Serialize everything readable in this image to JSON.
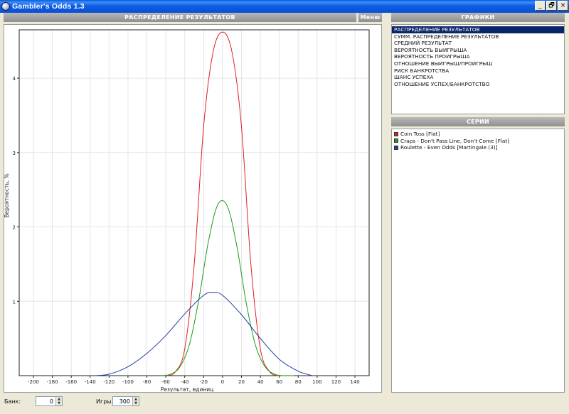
{
  "window": {
    "title": "Gambler's Odds 1.3",
    "buttons": [
      "_",
      "🗗",
      "×"
    ]
  },
  "chart_panel": {
    "header": "РАСПРЕДЕЛЕНИЕ РЕЗУЛЬТАТОВ",
    "menu_label": "Меню"
  },
  "graphs_panel": {
    "header": "ГРАФИКИ",
    "items": [
      "РАСПРЕДЕЛЕНИЕ РЕЗУЛЬТАТОВ",
      "СУММ. РАСПРЕДЕЛЕНИЕ РЕЗУЛЬТАТОВ",
      "СРЕДНИЙ РЕЗУЛЬТАТ",
      "ВЕРОЯТНОСТЬ ВЫИГРЫША",
      "ВЕРОЯТНОСТЬ ПРОИГРЫША",
      "ОТНОШЕНИЕ ВЫИГРЫШ/ПРОИГРЫШ",
      "РИСК БАНКРОТСТВА",
      "ШАНС УСПЕХА",
      "ОТНОШЕНИЕ УСПЕХ/БАНКРОТСТВО"
    ],
    "selected_index": 0
  },
  "series_panel": {
    "header": "СЕРИИ",
    "items": [
      {
        "label": "Coin Toss [Flat]",
        "color": "#e02020"
      },
      {
        "label": "Craps - Don't Pass Line, Don't Come [Flat]",
        "color": "#1e9a1e"
      },
      {
        "label": "Roulette - Even Odds [Martingale (3)]",
        "color": "#2040a0"
      }
    ]
  },
  "controls": {
    "bank_label": "Банк:",
    "bank_value": "0",
    "games_label": "Игры",
    "games_value": "300"
  },
  "chart_data": {
    "type": "line",
    "xlabel": "Результат, единиц",
    "ylabel": "Вероятность, %",
    "xlim": [
      -215,
      155
    ],
    "ylim": [
      0,
      4.65
    ],
    "xticks": [
      -200,
      -180,
      -160,
      -140,
      -120,
      -100,
      -80,
      -60,
      -40,
      -20,
      0,
      20,
      40,
      60,
      80,
      100,
      120,
      140
    ],
    "yticks": [
      1,
      2,
      3,
      4
    ],
    "grid": true,
    "series": [
      {
        "name": "Coin Toss [Flat]",
        "color": "#e02020",
        "x": [
          -60,
          -50,
          -40,
          -30,
          -20,
          -10,
          0,
          10,
          20,
          30,
          40,
          50,
          60
        ],
        "y": [
          0.0,
          0.05,
          0.36,
          1.49,
          3.35,
          4.35,
          4.62,
          4.35,
          3.35,
          1.49,
          0.36,
          0.05,
          0.0
        ]
      },
      {
        "name": "Craps - Don't Pass Line, Don't Come [Flat]",
        "color": "#1e9a1e",
        "x": [
          -65,
          -55,
          -45,
          -35,
          -25,
          -15,
          -5,
          5,
          15,
          25,
          35,
          45,
          55,
          65,
          75
        ],
        "y": [
          0.0,
          0.02,
          0.12,
          0.42,
          1.03,
          1.8,
          2.3,
          2.28,
          1.75,
          0.98,
          0.4,
          0.12,
          0.02,
          0.0,
          0.0
        ]
      },
      {
        "name": "Roulette - Even Odds [Martingale (3)]",
        "color": "#2040a0",
        "x": [
          -135,
          -120,
          -100,
          -80,
          -60,
          -40,
          -20,
          -10,
          0,
          20,
          40,
          60,
          80,
          95
        ],
        "y": [
          0.0,
          0.02,
          0.12,
          0.3,
          0.54,
          0.83,
          1.08,
          1.12,
          1.08,
          0.82,
          0.5,
          0.22,
          0.06,
          0.0
        ]
      }
    ]
  }
}
